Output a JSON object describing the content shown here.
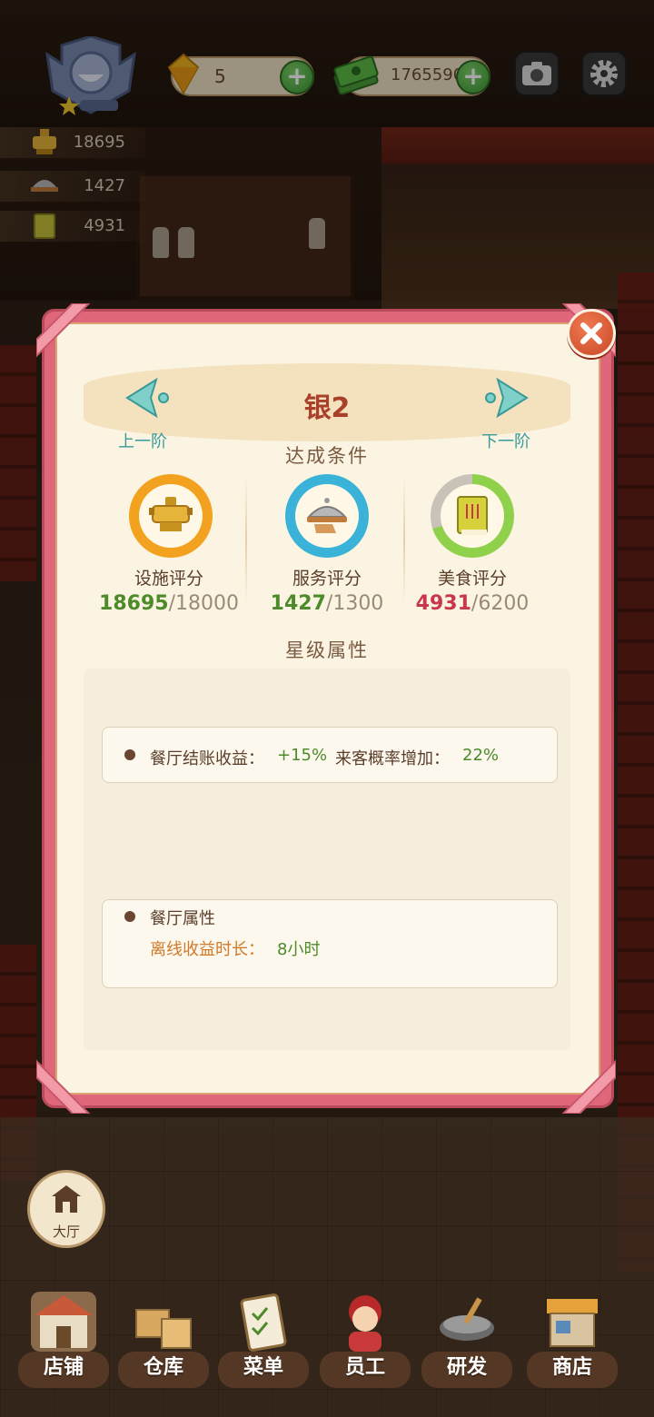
{
  "hud": {
    "gems": "5",
    "cash": "1765590",
    "facility_score": "18695",
    "service_score": "1427",
    "food_score": "4931"
  },
  "modal": {
    "title": "银2",
    "prev_label": "上一阶",
    "next_label": "下一阶",
    "conditions_title": "达成条件",
    "criteria": [
      {
        "label": "设施评分",
        "current": "18695",
        "required": "/18000",
        "icon": "hotpot-icon",
        "ring_color": "#f2a21f",
        "current_color": "#4c8a2a"
      },
      {
        "label": "服务评分",
        "current": "1427",
        "required": "/1300",
        "icon": "serving-tray-icon",
        "ring_color": "#3bb3d8",
        "current_color": "#4c8a2a"
      },
      {
        "label": "美食评分",
        "current": "4931",
        "required": "/6200",
        "icon": "recipe-book-icon",
        "ring_color": "#8fd14a",
        "current_color": "#c8384a"
      }
    ],
    "star_attr_title": "星级属性",
    "bonus_label_1": "餐厅结账收益：",
    "bonus_value_1": "+15%",
    "bonus_label_2": "来客概率增加：",
    "bonus_value_2": "22%",
    "restaurant_attr_title": "餐厅属性",
    "offline_label": "离线收益时长：",
    "offline_value": "8小时"
  },
  "hall_label": "大厅",
  "bottom_nav": [
    {
      "label": "店铺",
      "icon": "shop-building-icon"
    },
    {
      "label": "仓库",
      "icon": "warehouse-boxes-icon"
    },
    {
      "label": "菜单",
      "icon": "menu-clipboard-icon"
    },
    {
      "label": "员工",
      "icon": "staff-avatar-icon"
    },
    {
      "label": "研发",
      "icon": "research-wok-icon"
    },
    {
      "label": "商店",
      "icon": "store-stall-icon"
    }
  ]
}
